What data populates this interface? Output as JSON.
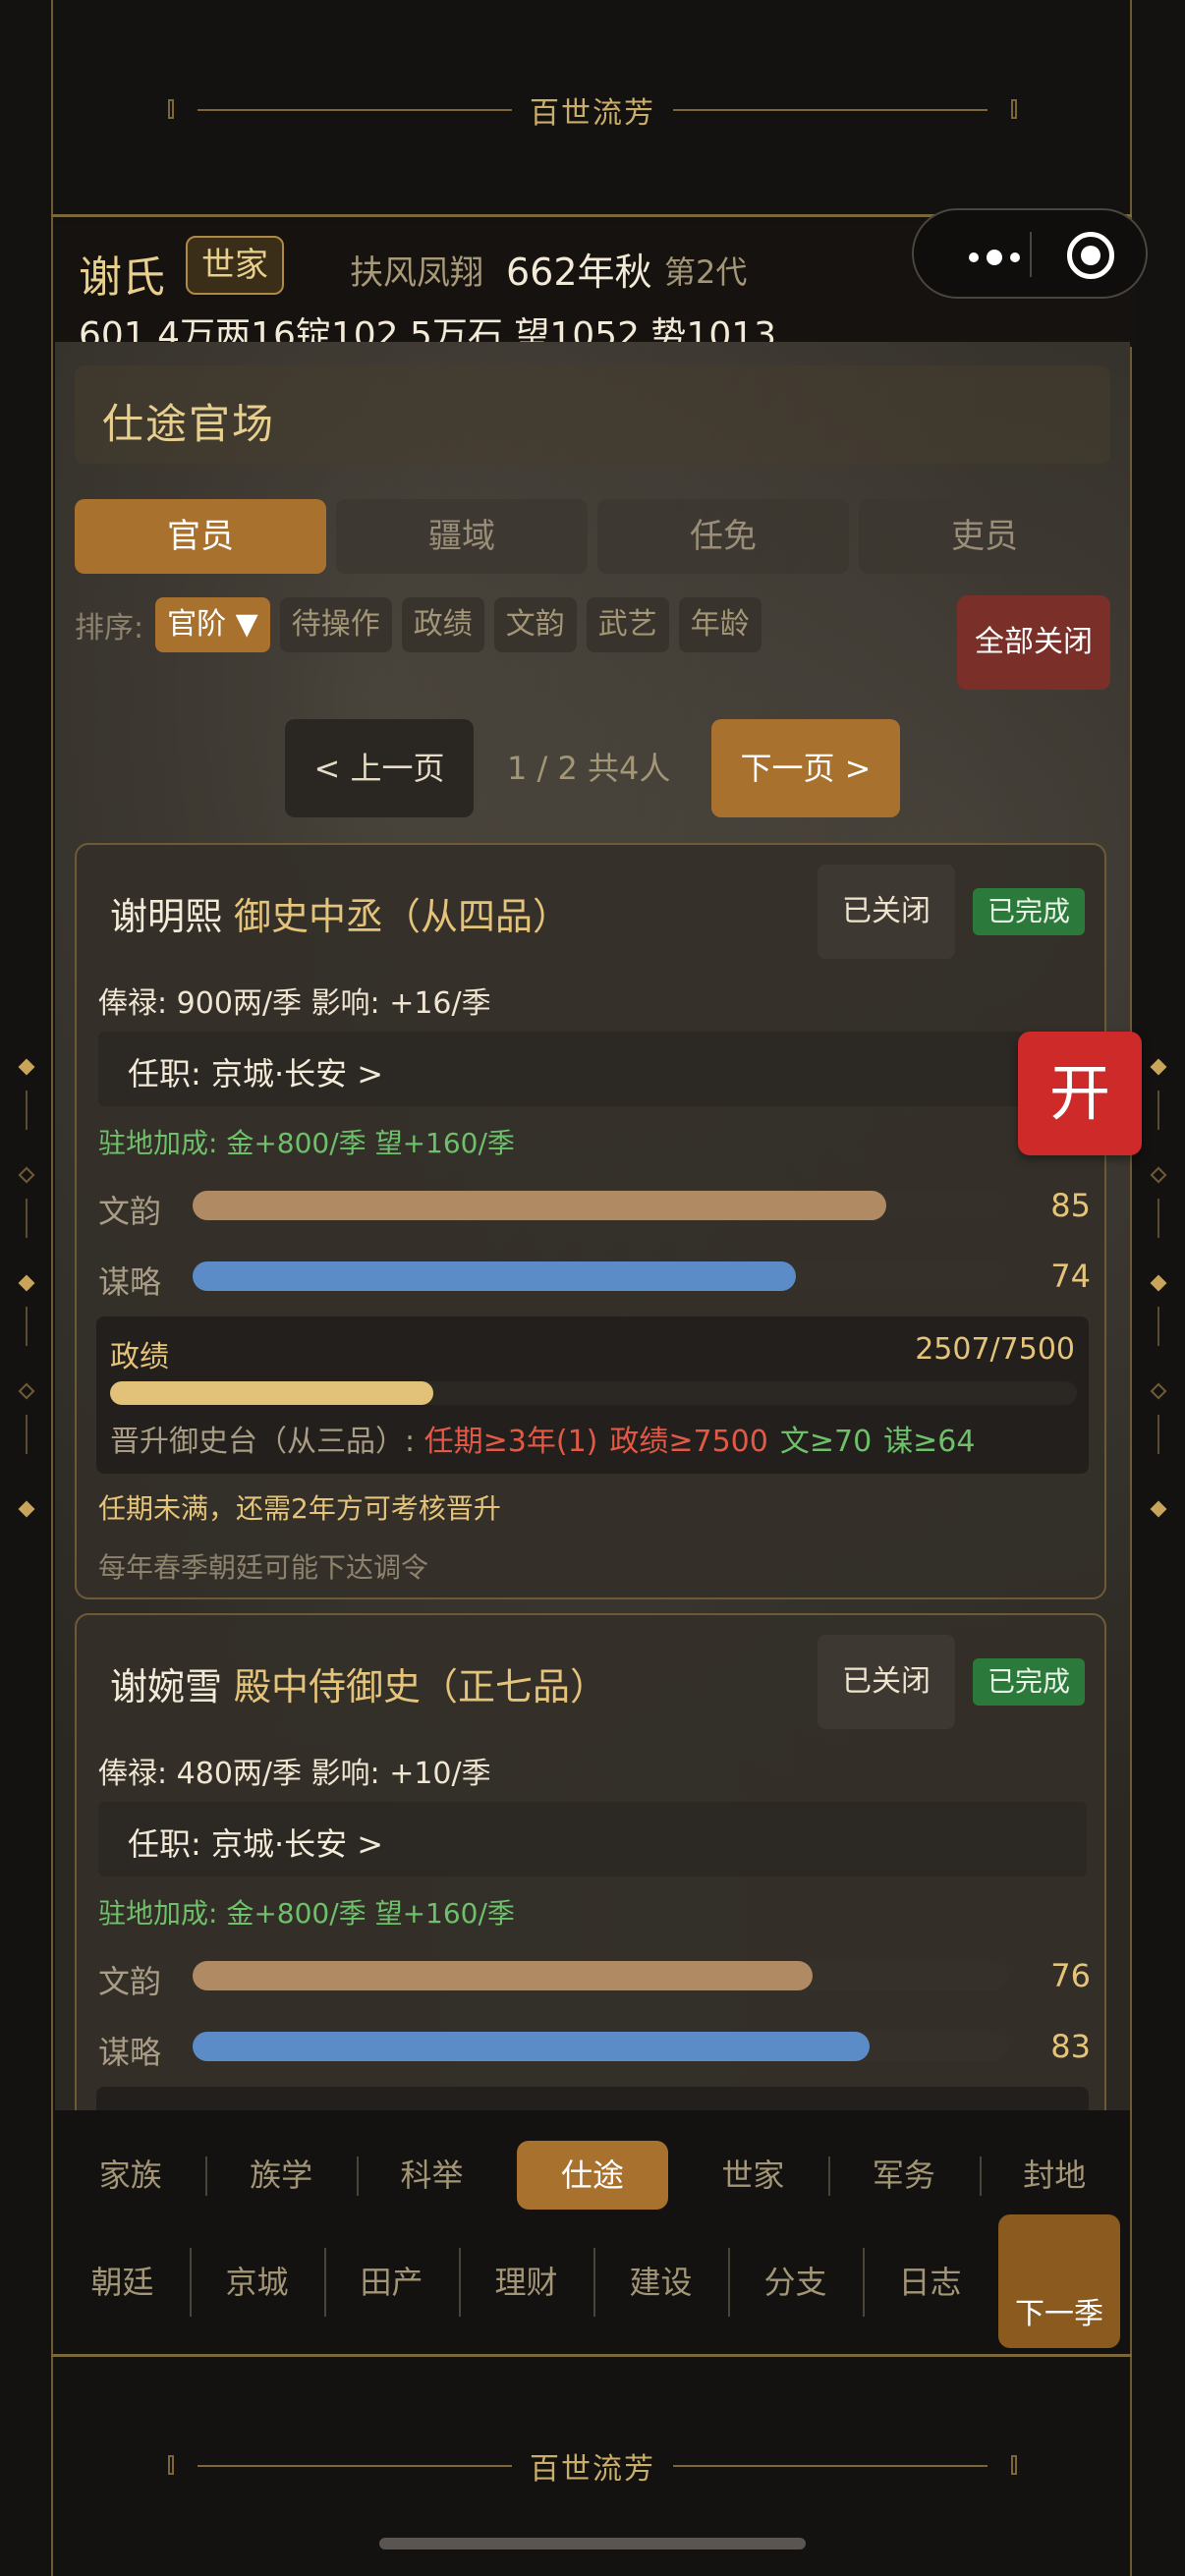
{
  "top_banner": {
    "title": "百世流芳"
  },
  "bottom_banner": {
    "title": "百世流芳"
  },
  "header": {
    "clan_name": "谢氏",
    "clan_badge": "世家",
    "motto": "扶风凤翔",
    "date": "662年秋",
    "generation": "第2代",
    "resources": "601.4万两16锭102.5万石  望1052 势1013"
  },
  "panel": {
    "title": "仕途官场",
    "tabs": [
      {
        "label": "官员",
        "active": true
      },
      {
        "label": "疆域",
        "active": false
      },
      {
        "label": "任免",
        "active": false
      },
      {
        "label": "吏员",
        "active": false
      }
    ],
    "sort_label": "排序:",
    "sort_chips": [
      "官阶 ▼",
      "待操作",
      "政绩",
      "文韵",
      "武艺",
      "年龄"
    ],
    "close_all": "全部关闭",
    "pager": {
      "prev": "< 上一页",
      "info": "1 / 2  共4人",
      "next": "下一页 >"
    }
  },
  "officials": [
    {
      "name": "谢明熙",
      "rank": "御史中丞（从四品）",
      "closed_label": "已关闭",
      "done_label": "已完成",
      "salary": "俸禄: 900两/季   影响: +16/季",
      "post": "任职: 京城·长安  >",
      "bonus": "驻地加成: 金+800/季  望+160/季",
      "stats": [
        {
          "label": "文韵",
          "value": "85",
          "pct": 85,
          "color": "#b08a62"
        },
        {
          "label": "谋略",
          "value": "74",
          "pct": 74,
          "color": "#5b8cc8"
        }
      ],
      "performance": {
        "label": "政绩",
        "value": "2507/7500",
        "pct": 33.4,
        "req_prefix": "晋升御史台（从三品）:",
        "req_term": "任期≥3年(1)",
        "req_perf": "政绩≥7500",
        "req_wen": "文≥70",
        "req_mou": "谋≥64"
      },
      "note1": "任期未满，还需2年方可考核晋升",
      "note2": "每年春季朝廷可能下达调令"
    },
    {
      "name": "谢婉雪",
      "rank": "殿中侍御史（正七品）",
      "closed_label": "已关闭",
      "done_label": "已完成",
      "salary": "俸禄: 480两/季   影响: +10/季",
      "post": "任职: 京城·长安  >",
      "bonus": "驻地加成: 金+800/季  望+160/季",
      "stats": [
        {
          "label": "文韵",
          "value": "76",
          "pct": 76,
          "color": "#b08a62"
        },
        {
          "label": "谋略",
          "value": "83",
          "pct": 83,
          "color": "#5b8cc8"
        }
      ]
    }
  ],
  "float_button": "开",
  "nav_primary": [
    {
      "label": "家族",
      "active": false
    },
    {
      "label": "族学",
      "active": false
    },
    {
      "label": "科举",
      "active": false
    },
    {
      "label": "仕途",
      "active": true
    },
    {
      "label": "世家",
      "active": false
    },
    {
      "label": "军务",
      "active": false
    },
    {
      "label": "封地",
      "active": false
    }
  ],
  "nav_secondary": [
    "朝廷",
    "京城",
    "田产",
    "理财",
    "建设",
    "分支",
    "日志"
  ],
  "next_season": "下一季"
}
